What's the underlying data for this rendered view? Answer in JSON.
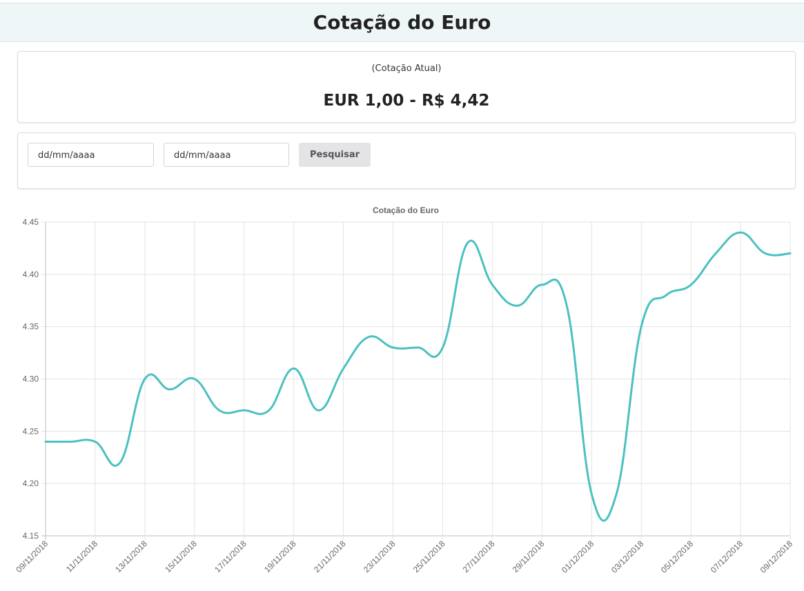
{
  "header": {
    "title": "Cotação do Euro"
  },
  "rate": {
    "label": "(Cotação Atual)",
    "value": "EUR 1,00 - R$ 4,42"
  },
  "search": {
    "from_placeholder": "dd/mm/aaaa",
    "to_placeholder": "dd/mm/aaaa",
    "button_label": "Pesquisar"
  },
  "chart_data": {
    "type": "line",
    "title": "Cotação do Euro",
    "xlabel": "",
    "ylabel": "",
    "ylim": [
      4.15,
      4.45
    ],
    "yticks": [
      "4.45",
      "4.40",
      "4.35",
      "4.30",
      "4.25",
      "4.20",
      "4.15"
    ],
    "grid": true,
    "line_color": "#4bc0c0",
    "x": [
      "09/11/2018",
      "10/11/2018",
      "11/11/2018",
      "12/11/2018",
      "13/11/2018",
      "14/11/2018",
      "15/11/2018",
      "16/11/2018",
      "17/11/2018",
      "18/11/2018",
      "19/11/2018",
      "20/11/2018",
      "21/11/2018",
      "22/11/2018",
      "23/11/2018",
      "24/11/2018",
      "25/11/2018",
      "26/11/2018",
      "27/11/2018",
      "28/11/2018",
      "29/11/2018",
      "30/11/2018",
      "01/12/2018",
      "02/12/2018",
      "03/12/2018",
      "04/12/2018",
      "05/12/2018",
      "06/12/2018",
      "07/12/2018",
      "08/12/2018",
      "09/12/2018"
    ],
    "tick_labels": [
      "09/11/2018",
      "11/11/2018",
      "13/11/2018",
      "15/11/2018",
      "17/11/2018",
      "19/11/2018",
      "21/11/2018",
      "23/11/2018",
      "25/11/2018",
      "27/11/2018",
      "29/11/2018",
      "01/12/2018",
      "03/12/2018",
      "05/12/2018",
      "07/12/2018",
      "09/12/2018"
    ],
    "series": [
      {
        "values": [
          4.24,
          4.24,
          4.24,
          4.22,
          4.3,
          4.29,
          4.3,
          4.27,
          4.27,
          4.27,
          4.31,
          4.27,
          4.31,
          4.34,
          4.33,
          4.33,
          4.33,
          4.43,
          4.39,
          4.37,
          4.39,
          4.37,
          4.19,
          4.19,
          4.35,
          4.38,
          4.39,
          4.42,
          4.44,
          4.42,
          4.42
        ]
      }
    ]
  }
}
